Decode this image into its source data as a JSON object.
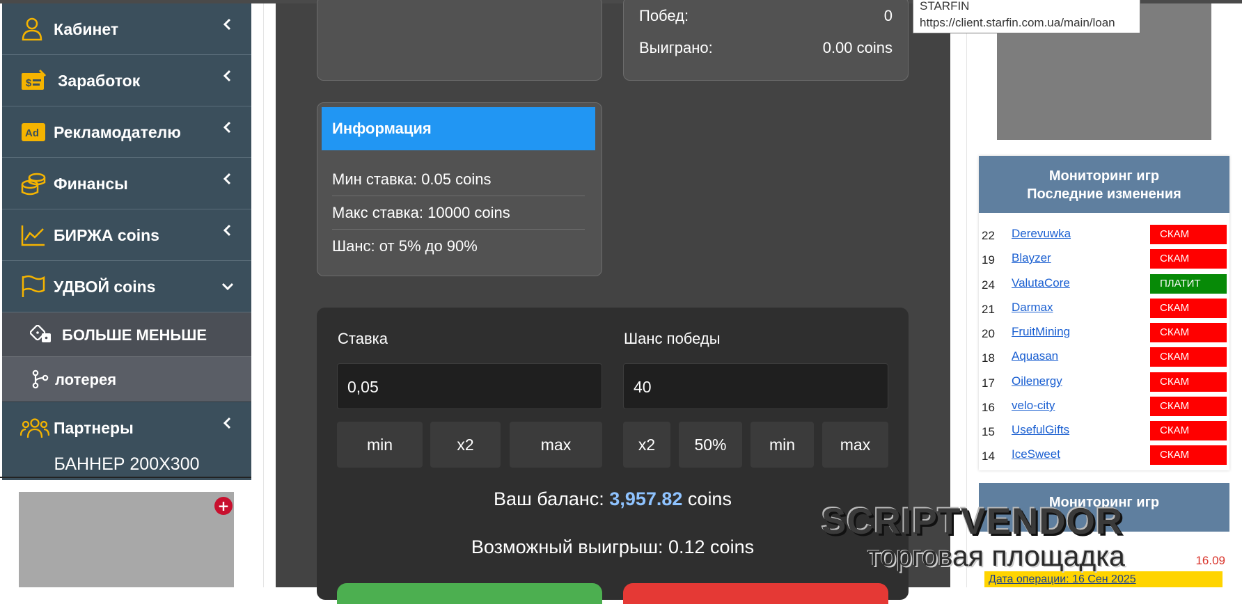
{
  "sidebar": {
    "items": [
      {
        "label": "Кабинет",
        "icon": "user-icon"
      },
      {
        "label": "Заработок",
        "icon": "money-check-icon"
      },
      {
        "label": "Рекламодателю",
        "icon": "ad-icon"
      },
      {
        "label": "Финансы",
        "icon": "coins-icon"
      },
      {
        "label": "БИРЖА coins",
        "icon": "chart-line-icon"
      },
      {
        "label": "УДВОЙ coins",
        "icon": "flag-icon"
      }
    ],
    "sub_items": [
      {
        "label": "БОЛЬШЕ МЕНЬШЕ",
        "icon": "dice-icon"
      },
      {
        "label": "лотерея",
        "icon": "branch-icon"
      }
    ],
    "partners": {
      "label": "Партнеры",
      "icon": "users-icon"
    },
    "banner_title": "БАННЕР 200X300",
    "banner_plus": "+"
  },
  "stats": {
    "wins_label": "Побед:",
    "wins_value": "0",
    "won_label": "Выиграно:",
    "won_value": "0.00 coins"
  },
  "info": {
    "title": "Информация",
    "lines": [
      "Мин ставка: 0.05 coins",
      "Макс ставка: 10000 coins",
      "Шанс: от 5% до 90%"
    ]
  },
  "game": {
    "bet_label": "Ставка",
    "bet_value": "0,05",
    "chance_label": "Шанс победы",
    "chance_value": "40",
    "bet_buttons": [
      "min",
      "x2",
      "max"
    ],
    "chance_buttons": [
      "x2",
      "50%",
      "min",
      "max"
    ],
    "balance_prefix": "Ваш баланс:",
    "balance_value": "3,957.82",
    "balance_suffix": "coins",
    "possible_win": "Возможный выигрыш: 0.12 coins"
  },
  "tooltip": {
    "title": "STARFIN",
    "url": "https://client.starfin.com.ua/main/loan"
  },
  "monitor": {
    "title_line1": "Мониторинг игр",
    "title_line2": "Последние изменения",
    "rows": [
      {
        "num": "22",
        "name": "Derevuwka",
        "status": "СКАМ"
      },
      {
        "num": "19",
        "name": "Blayzer",
        "status": "СКАМ"
      },
      {
        "num": "24",
        "name": "ValutaCore",
        "status": "ПЛАТИТ"
      },
      {
        "num": "21",
        "name": "Darmax",
        "status": "СКАМ"
      },
      {
        "num": "20",
        "name": "FruitMining",
        "status": "СКАМ"
      },
      {
        "num": "18",
        "name": "Aquasan",
        "status": "СКАМ"
      },
      {
        "num": "17",
        "name": "Oilenergy",
        "status": "СКАМ"
      },
      {
        "num": "16",
        "name": "velo-city",
        "status": "СКАМ"
      },
      {
        "num": "15",
        "name": "UsefulGifts",
        "status": "СКАМ"
      },
      {
        "num": "14",
        "name": "IceSweet",
        "status": "СКАМ"
      }
    ]
  },
  "monitor2": {
    "title": "Мониторинг игр",
    "date": "16.09",
    "operation": "Дата операции: 16 Сен 2025"
  },
  "watermark": {
    "line1": "SCRIPTVENDOR",
    "line2": "торговая площадка"
  },
  "colors": {
    "accent_blue": "#2196f3",
    "scam_red": "#ff0000",
    "pay_green": "#078a07",
    "sidebar_bg": "#3b4f5c",
    "icon_gold": "#f5b400",
    "balance_blue": "#8fc3ff",
    "go_green": "#4caf50",
    "go_red": "#e53935"
  }
}
